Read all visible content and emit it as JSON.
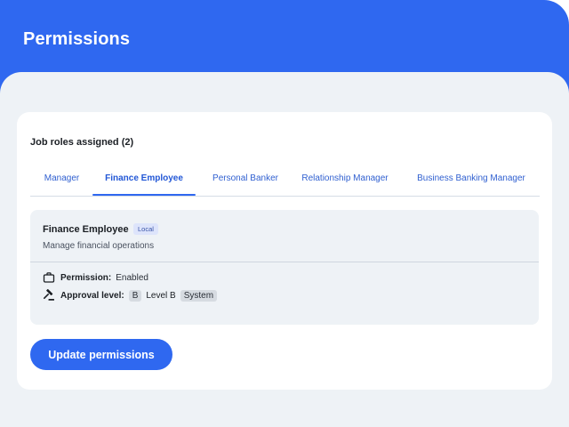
{
  "page": {
    "title": "Permissions"
  },
  "roles_section": {
    "heading": "Job roles assigned (2)",
    "tabs": [
      {
        "label": "Manager",
        "active": false
      },
      {
        "label": "Finance Employee",
        "active": true
      },
      {
        "label": "Personal Banker",
        "active": false
      },
      {
        "label": "Relationship Manager",
        "active": false
      },
      {
        "label": "Business Banking Manager",
        "active": false
      }
    ]
  },
  "role_detail": {
    "name": "Finance Employee",
    "badge": "Local",
    "description": "Manage financial operations",
    "permission": {
      "label": "Permission:",
      "value": "Enabled",
      "icon": "briefcase-icon"
    },
    "approval": {
      "label": "Approval level:",
      "code": "B",
      "level": "Level B",
      "scope": "System",
      "icon": "gavel-icon"
    }
  },
  "actions": {
    "update_label": "Update permissions"
  },
  "colors": {
    "primary": "#2f68f0",
    "background": "#eef2f6",
    "card": "#ffffff"
  }
}
